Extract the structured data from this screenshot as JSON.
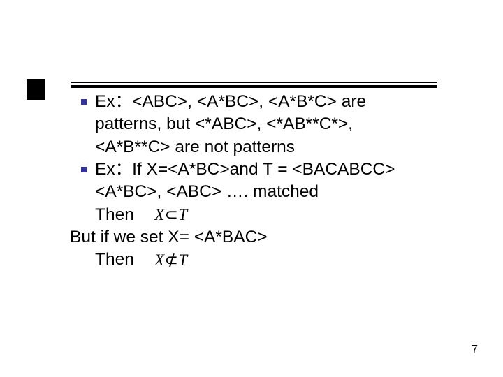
{
  "rule": {
    "present": true
  },
  "bullets": {
    "b1": {
      "line1": "Ex：<ABC>, <A*BC>, <A*B*C> are",
      "line2": "patterns, but <*ABC>, <*AB**C*>,",
      "line3": "<A*B**C> are not patterns"
    },
    "b2": {
      "line1": "Ex：If X=<A*BC>and T = <BACABCC>",
      "line2": "<A*BC>, <ABC> …. matched",
      "then": "Then",
      "butif": "But if we set X= <A*BAC>",
      "then2": "Then"
    }
  },
  "math": {
    "member": {
      "x": "X",
      "rel": "⊂",
      "t": "T"
    },
    "notmember": {
      "x": "X",
      "rel": "⊄",
      "t": "T"
    }
  },
  "pageNumber": "7"
}
